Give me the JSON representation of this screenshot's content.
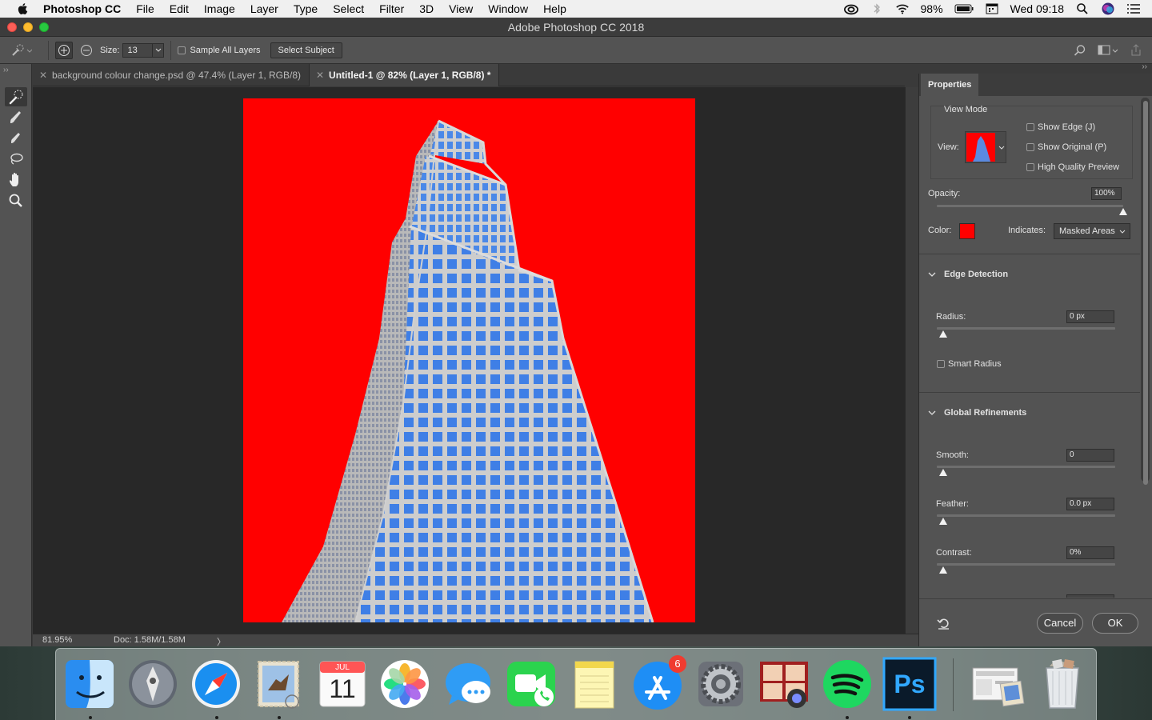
{
  "menubar": {
    "app_name": "Photoshop CC",
    "items": [
      "File",
      "Edit",
      "Image",
      "Layer",
      "Type",
      "Select",
      "Filter",
      "3D",
      "View",
      "Window",
      "Help"
    ],
    "battery": "98%",
    "clock": "Wed 09:18"
  },
  "window": {
    "title": "Adobe Photoshop CC 2018"
  },
  "options_bar": {
    "size_label": "Size:",
    "size_value": "13",
    "sample_all_layers": "Sample All Layers",
    "select_subject": "Select Subject"
  },
  "tabs": [
    {
      "label": "background colour change.psd @ 47.4% (Layer 1, RGB/8)",
      "active": false
    },
    {
      "label": "Untitled-1 @ 82% (Layer 1, RGB/8) *",
      "active": true
    }
  ],
  "canvas": {
    "background_color": "#ff0000",
    "building_glass": "#4a88e8",
    "building_frame": "#c9c9c9"
  },
  "statusbar": {
    "zoom": "81.95%",
    "doc": "Doc: 1.58M/1.58M",
    "arrow": "〉"
  },
  "properties": {
    "tab": "Properties",
    "view_mode_title": "View Mode",
    "view_label": "View:",
    "show_edge": "Show Edge (J)",
    "show_original": "Show Original (P)",
    "high_quality_preview": "High Quality Preview",
    "opacity_label": "Opacity:",
    "opacity_value": "100%",
    "opacity_level": 1.0,
    "color_label": "Color:",
    "color_swatch": "#ff0000",
    "indicates_label": "Indicates:",
    "indicates_value": "Masked Areas",
    "edge_detection_title": "Edge Detection",
    "radius_label": "Radius:",
    "radius_value": "0 px",
    "smart_radius": "Smart Radius",
    "global_refinements_title": "Global Refinements",
    "smooth_label": "Smooth:",
    "smooth_value": "0",
    "feather_label": "Feather:",
    "feather_value": "0.0 px",
    "contrast_label": "Contrast:",
    "contrast_value": "0%",
    "cancel": "Cancel",
    "ok": "OK"
  },
  "dock": {
    "calendar_month": "JUL",
    "calendar_day": "11",
    "app_store_badge": "6",
    "photoshop_label": "Ps",
    "apps": [
      "finder-icon",
      "launchpad-icon",
      "safari-icon",
      "mail-icon",
      "calendar-icon",
      "photos-icon",
      "messages-icon",
      "facetime-icon",
      "notes-icon",
      "app-store-icon",
      "system-preferences-icon",
      "photo-booth-icon",
      "spotify-icon",
      "photoshop-icon",
      "downloads-stack-icon",
      "trash-icon"
    ]
  }
}
